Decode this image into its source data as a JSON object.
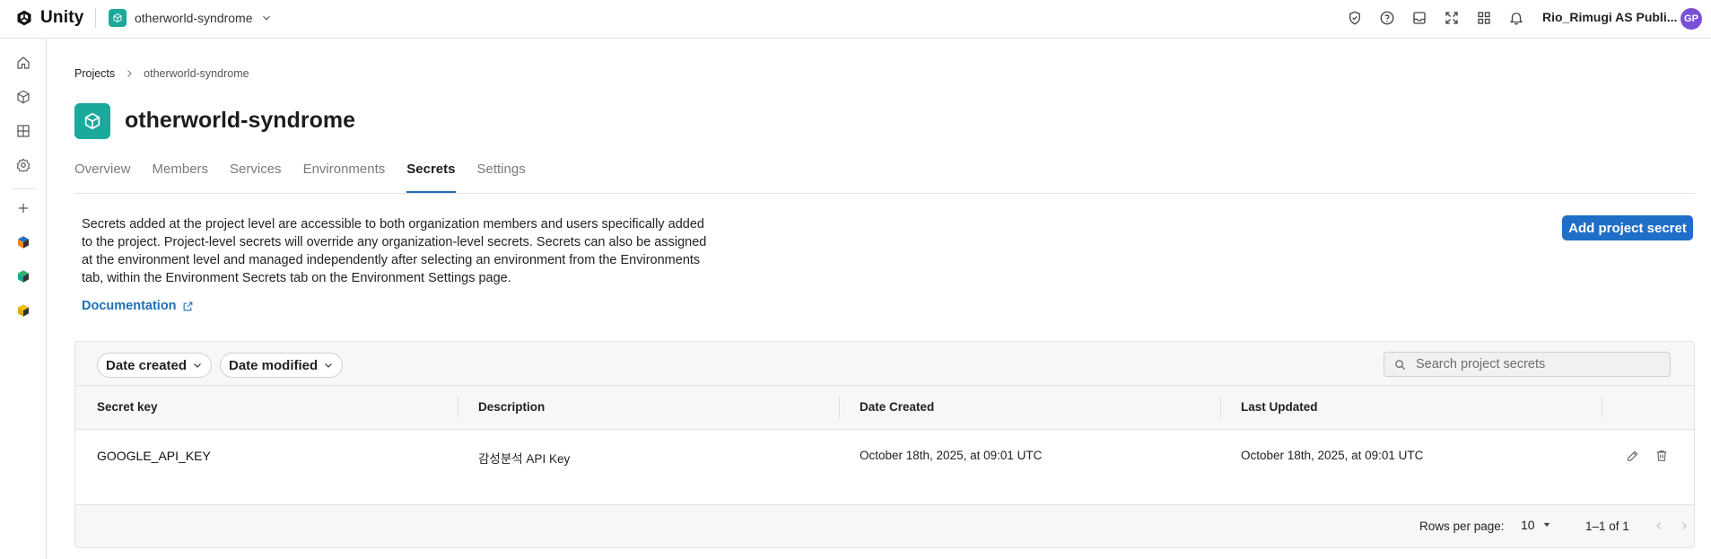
{
  "app": {
    "brand": "Unity"
  },
  "topbar": {
    "project_name": "otherworld-syndrome",
    "org_name": "Rio_Rimugi AS Publi...",
    "avatar_initials": "GP",
    "icons": [
      "shield-check-icon",
      "help-icon",
      "inbox-icon",
      "expand-icon",
      "apps-grid-icon",
      "bell-icon"
    ]
  },
  "sidebar": {
    "items": [
      "home-icon",
      "cube-icon",
      "grid-icon",
      "settings-icon",
      "plus-icon",
      "cloud-app-icon",
      "cloud-app-icon",
      "cloud-app-icon"
    ]
  },
  "breadcrumb": {
    "root": "Projects",
    "current": "otherworld-syndrome"
  },
  "page": {
    "title": "otherworld-syndrome"
  },
  "tabs": [
    {
      "label": "Overview",
      "active": false
    },
    {
      "label": "Members",
      "active": false
    },
    {
      "label": "Services",
      "active": false
    },
    {
      "label": "Environments",
      "active": false
    },
    {
      "label": "Secrets",
      "active": true
    },
    {
      "label": "Settings",
      "active": false
    }
  ],
  "secrets": {
    "description": "Secrets added at the project level are accessible to both organization members and users specifically added to the project. Project-level secrets will override any organization-level secrets. Secrets can also be assigned at the environment level and managed independently after selecting an environment from the Environments tab, within the Environment Secrets tab on the Environment Settings page.",
    "documentation_label": "Documentation",
    "add_button_label": "Add project secret",
    "filters": [
      "Date created",
      "Date modified"
    ],
    "search_placeholder": "Search project secrets",
    "columns": [
      "Secret key",
      "Description",
      "Date Created",
      "Last Updated"
    ],
    "rows": [
      {
        "key": "GOOGLE_API_KEY",
        "description": "감성분석 API Key",
        "date_created": "October 18th, 2025, at 09:01 UTC",
        "last_updated": "October 18th, 2025, at 09:01 UTC"
      }
    ],
    "pagination": {
      "rows_per_page_label": "Rows per page:",
      "rows_per_page": "10",
      "range": "1–1 of 1"
    }
  },
  "colors": {
    "accent": "#1f6fc8",
    "project_badge": "#1aa99a",
    "avatar": "#7a4fd6"
  }
}
